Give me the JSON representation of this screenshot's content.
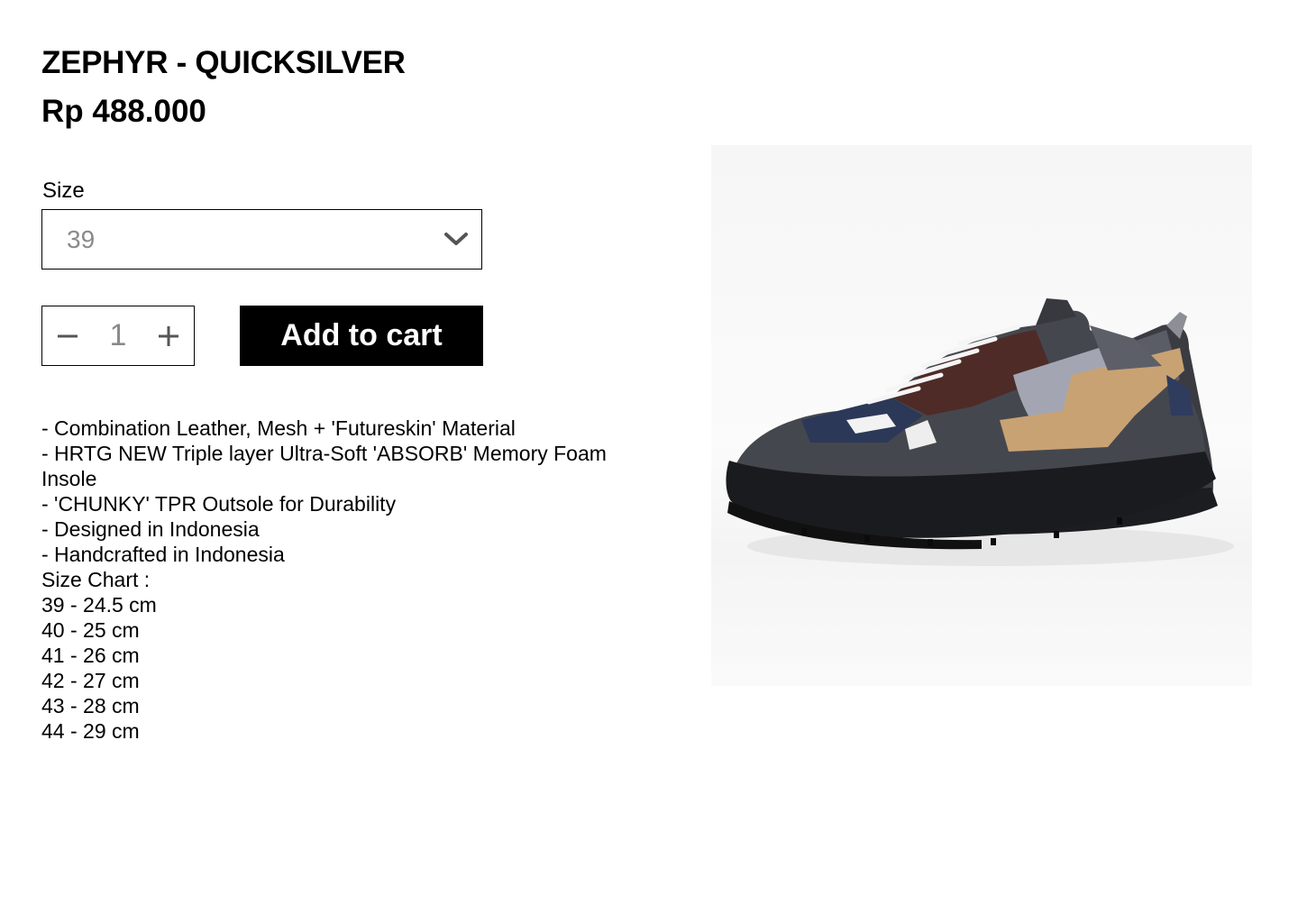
{
  "product": {
    "title": "ZEPHYR - QUICKSILVER",
    "price": "Rp 488.000"
  },
  "size_selector": {
    "label": "Size",
    "selected": "39",
    "icon": "chevron-down-icon"
  },
  "quantity": {
    "value": "1",
    "minus_icon": "minus-icon",
    "plus_icon": "plus-icon"
  },
  "cart": {
    "add_label": "Add to cart"
  },
  "description": {
    "lines": [
      "- Combination Leather, Mesh + 'Futureskin' Material",
      "- HRTG NEW Triple layer Ultra-Soft 'ABSORB' Memory Foam Insole",
      "- 'CHUNKY' TPR Outsole for Durability",
      "- Designed in Indonesia",
      "- Handcrafted in Indonesia",
      "Size Chart :",
      "39 - 24.5 cm",
      "40 - 25 cm",
      "41 - 26 cm",
      "42 - 27 cm",
      "43 - 28 cm",
      "44 - 29 cm"
    ]
  },
  "colors": {
    "button_bg": "#000000",
    "button_text": "#ffffff",
    "muted_text": "#8a8a8a"
  }
}
